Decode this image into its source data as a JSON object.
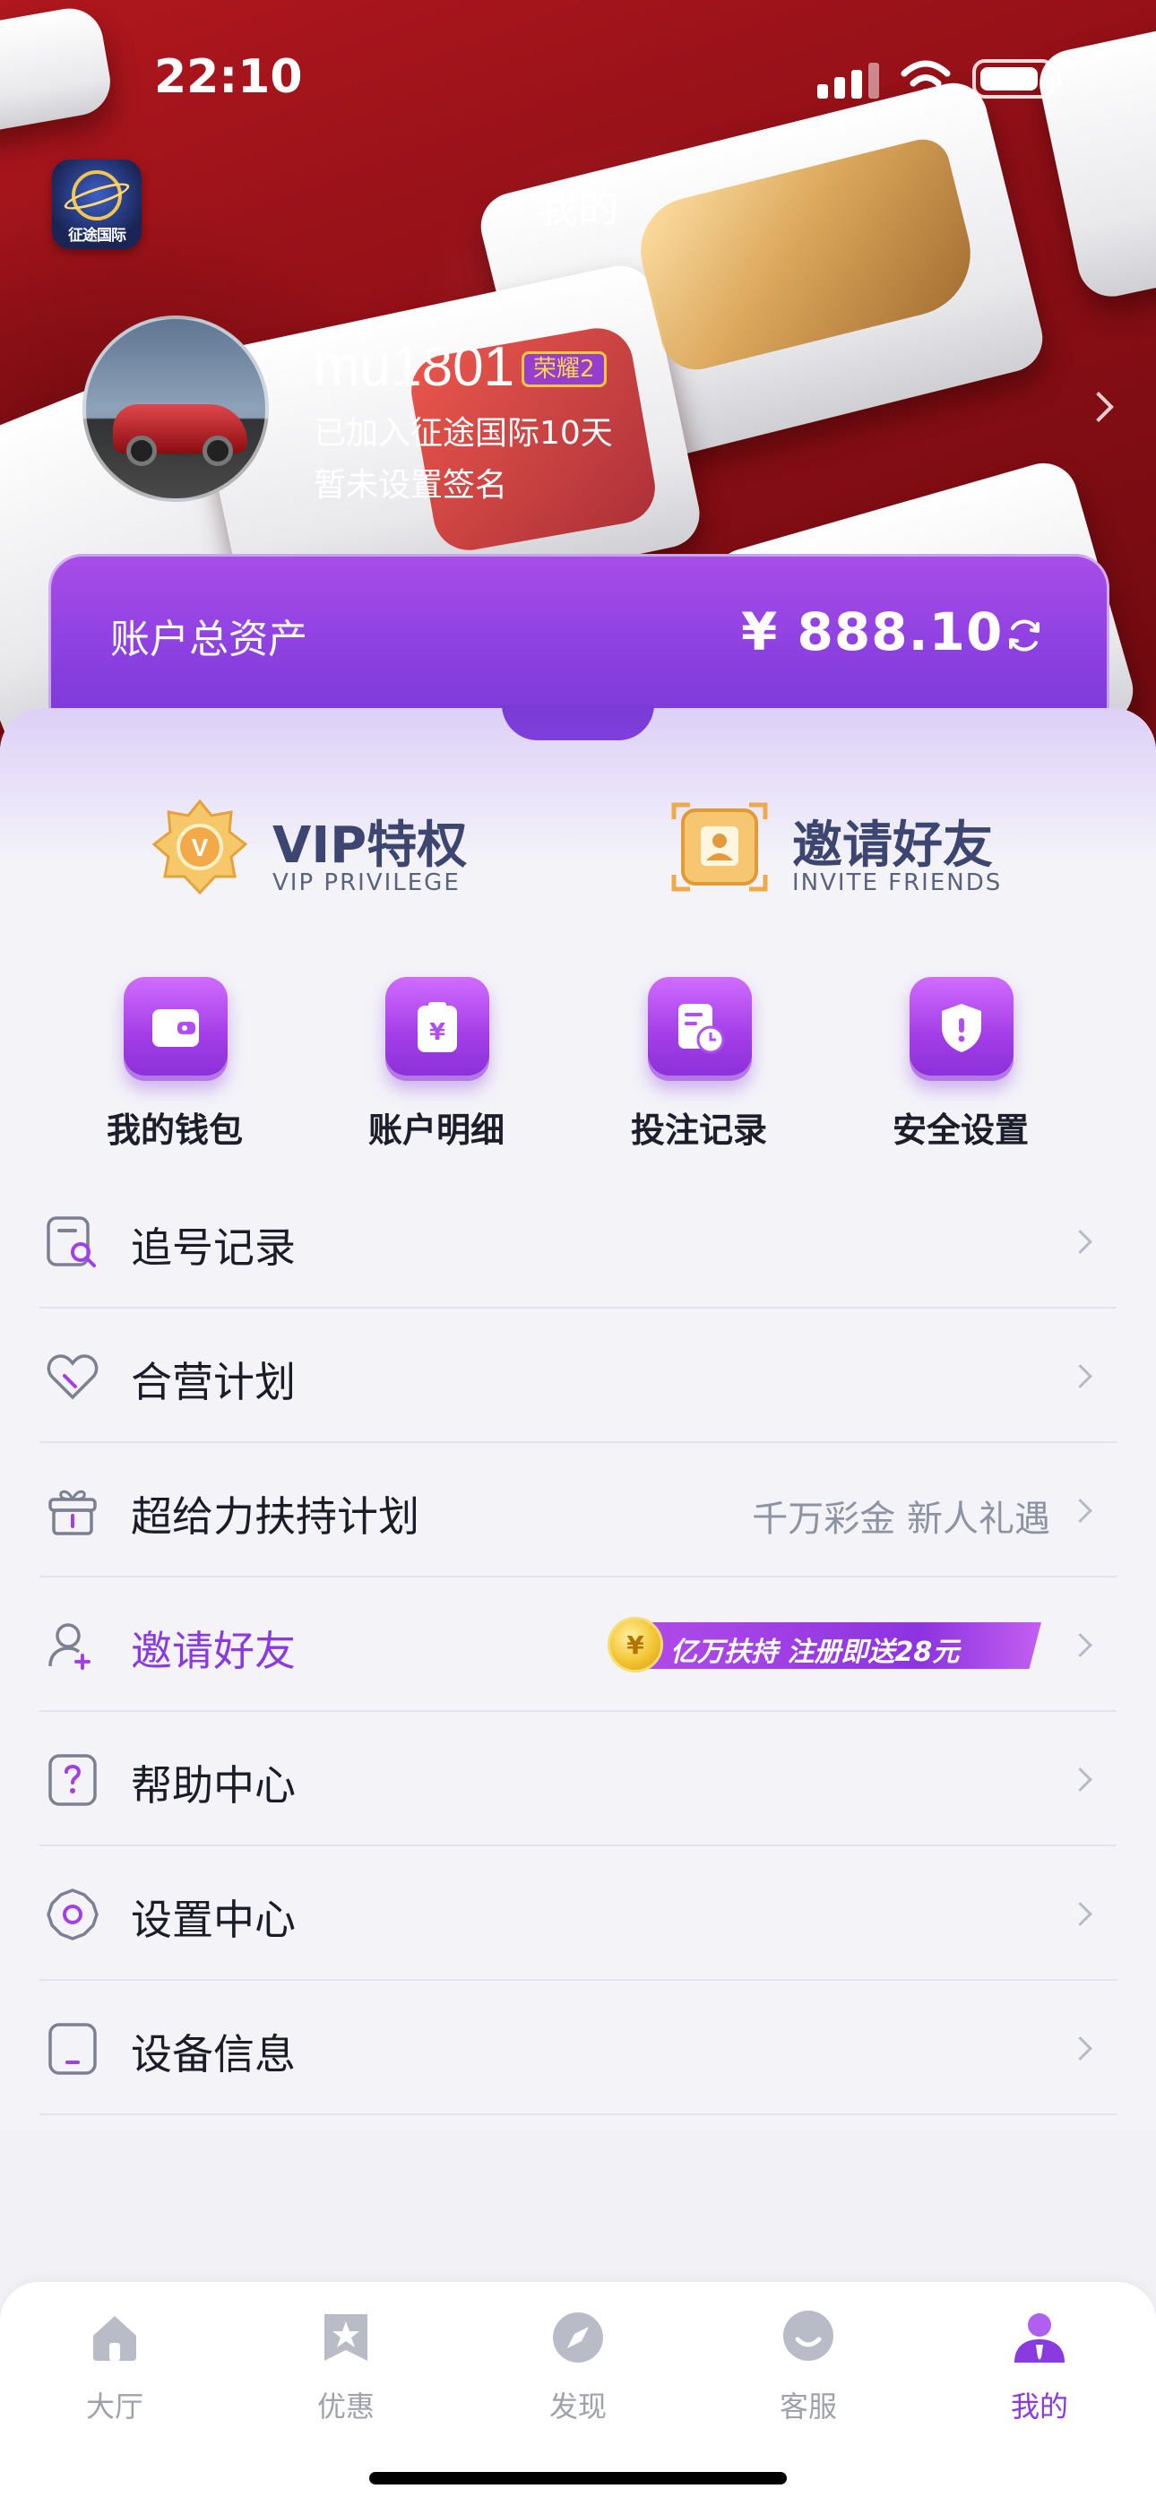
{
  "status": {
    "time": "22:10"
  },
  "app": {
    "logo_text": "征途国际",
    "title": "我的"
  },
  "profile": {
    "username": "mu1801",
    "rank_badge": "荣耀2",
    "joined": "已加入征途国际10天",
    "signature": "暂未设置签名"
  },
  "assets": {
    "label": "账户总资产",
    "value": "¥ 888.10"
  },
  "features": {
    "vip": {
      "title": "VIP特权",
      "subtitle": "VIP PRIVILEGE"
    },
    "invite": {
      "title": "邀请好友",
      "subtitle": "INVITE FRIENDS"
    }
  },
  "quick_actions": [
    {
      "label": "我的钱包",
      "icon": "wallet-icon"
    },
    {
      "label": "账户明细",
      "icon": "yuan-receipt-icon"
    },
    {
      "label": "投注记录",
      "icon": "bet-record-icon"
    },
    {
      "label": "安全设置",
      "icon": "shield-icon"
    }
  ],
  "menu": [
    {
      "label": "追号记录",
      "icon": "search-record-icon",
      "right": ""
    },
    {
      "label": "合营计划",
      "icon": "partnership-heart-icon",
      "right": ""
    },
    {
      "label": "超给力扶持计划",
      "icon": "gift-icon",
      "right": "千万彩金 新人礼遇"
    },
    {
      "label": "邀请好友",
      "icon": "invite-user-icon",
      "right": "",
      "promo": "亿万扶持 注册即送28元"
    },
    {
      "label": "帮助中心",
      "icon": "help-icon",
      "right": ""
    },
    {
      "label": "设置中心",
      "icon": "settings-gear-icon",
      "right": ""
    },
    {
      "label": "设备信息",
      "icon": "device-icon",
      "right": ""
    }
  ],
  "tabs": [
    {
      "label": "大厅",
      "icon": "home-icon",
      "active": false
    },
    {
      "label": "优惠",
      "icon": "star-badge-icon",
      "active": false
    },
    {
      "label": "发现",
      "icon": "compass-icon",
      "active": false
    },
    {
      "label": "客服",
      "icon": "support-chat-icon",
      "active": false
    },
    {
      "label": "我的",
      "icon": "profile-icon",
      "active": true
    }
  ],
  "colors": {
    "accent": "#8a3be0",
    "hero_red": "#a3141b",
    "card_purple": "#9844e4"
  }
}
